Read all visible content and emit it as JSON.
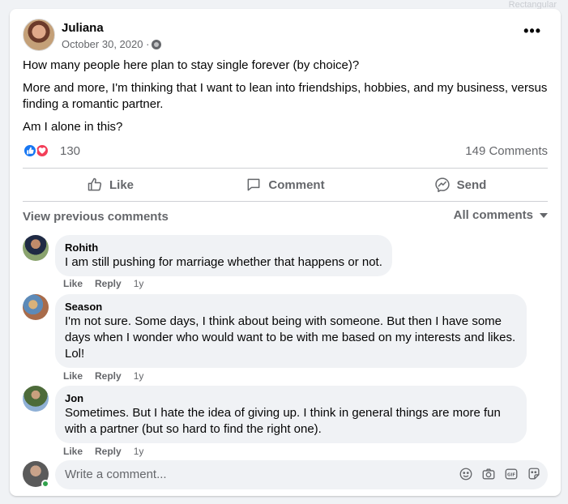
{
  "background_tab": "Rectangular",
  "post": {
    "author": "Juliana",
    "date": "October 30, 2020 ·",
    "more_label": "•••",
    "paragraphs": [
      "How many people here plan to stay single forever (by choice)?",
      "More and more, I'm thinking that I want to lean into friendships, hobbies, and my business, versus finding a romantic partner.",
      "Am I alone in this?"
    ],
    "reaction_count": "130",
    "comment_count": "149 Comments"
  },
  "actions": {
    "like": "Like",
    "comment": "Comment",
    "send": "Send"
  },
  "comments_header": {
    "view_previous": "View previous comments",
    "filter": "All comments"
  },
  "comments": [
    {
      "name": "Rohith",
      "text": "I am still pushing for marriage whether that happens or not.",
      "like": "Like",
      "reply": "Reply",
      "time": "1y"
    },
    {
      "name": "Season",
      "text": "I'm not sure. Some days, I think about being with someone. But then I have some days when I wonder who would want to be with me based on my interests and likes. Lol!",
      "like": "Like",
      "reply": "Reply",
      "time": "1y"
    },
    {
      "name": "Jon",
      "text": "Sometimes. But I hate the idea of giving up. I think in general things are more fun with a partner (but so hard to find the right one).",
      "like": "Like",
      "reply": "Reply",
      "time": "1y"
    }
  ],
  "composer": {
    "placeholder": "Write a comment..."
  },
  "colors": {
    "like_blue": "#1877f2",
    "love_red": "#f33e58",
    "secondary_text": "#65676b",
    "bubble_bg": "#f0f2f5",
    "online_green": "#31a24c"
  },
  "icons": [
    "globe-icon",
    "more-icon",
    "like-reaction-icon",
    "love-reaction-icon",
    "thumbs-up-icon",
    "comment-icon",
    "messenger-icon",
    "caret-down-icon",
    "emoji-icon",
    "camera-icon",
    "gif-icon",
    "sticker-icon"
  ]
}
